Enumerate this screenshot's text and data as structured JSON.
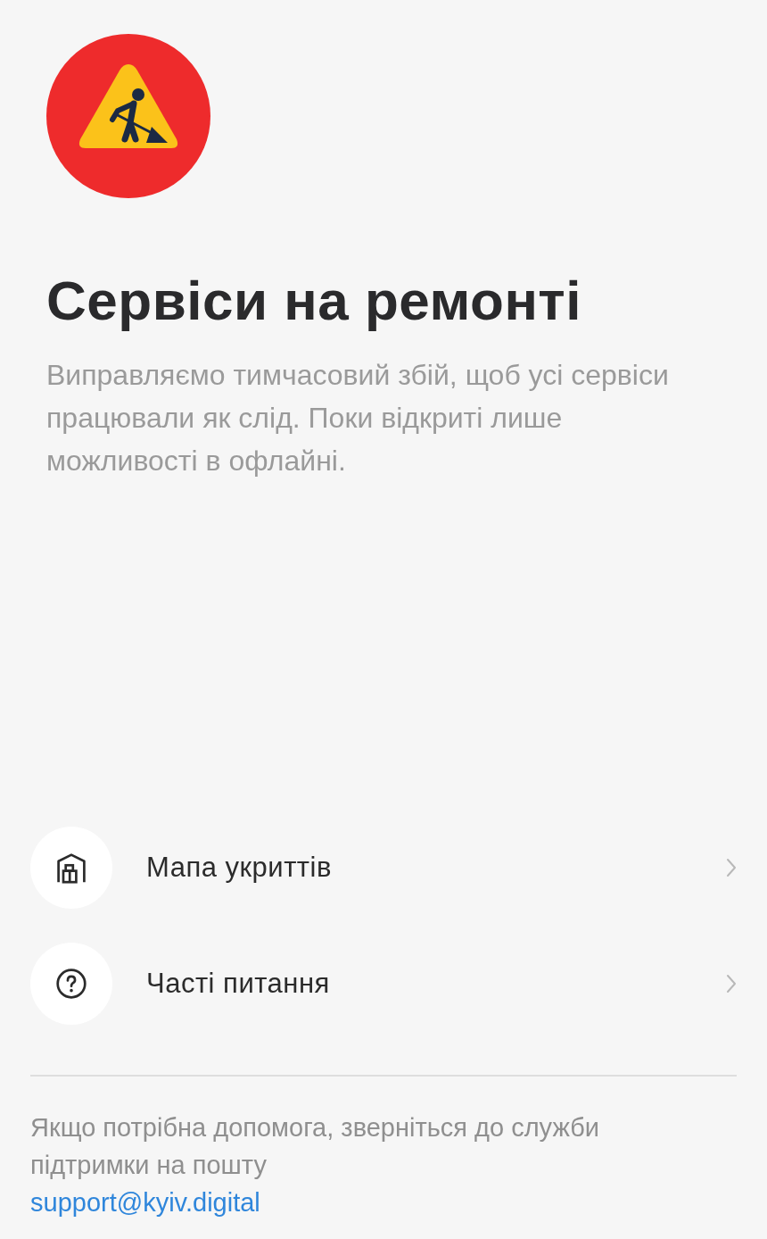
{
  "title": "Сервіси на ремонті",
  "description": "Виправляємо тимчасовий збій, щоб усі сервіси працювали як слід. Поки відкриті лише можливості в офлайні.",
  "menu": [
    {
      "kind": "shelter",
      "label": "Мапа укриттів"
    },
    {
      "kind": "faq",
      "label": "Часті питання"
    }
  ],
  "footer": {
    "text": "Якщо потрібна допомога, зверніться до служби підтримки на пошту",
    "email": "support@kyiv.digital"
  }
}
